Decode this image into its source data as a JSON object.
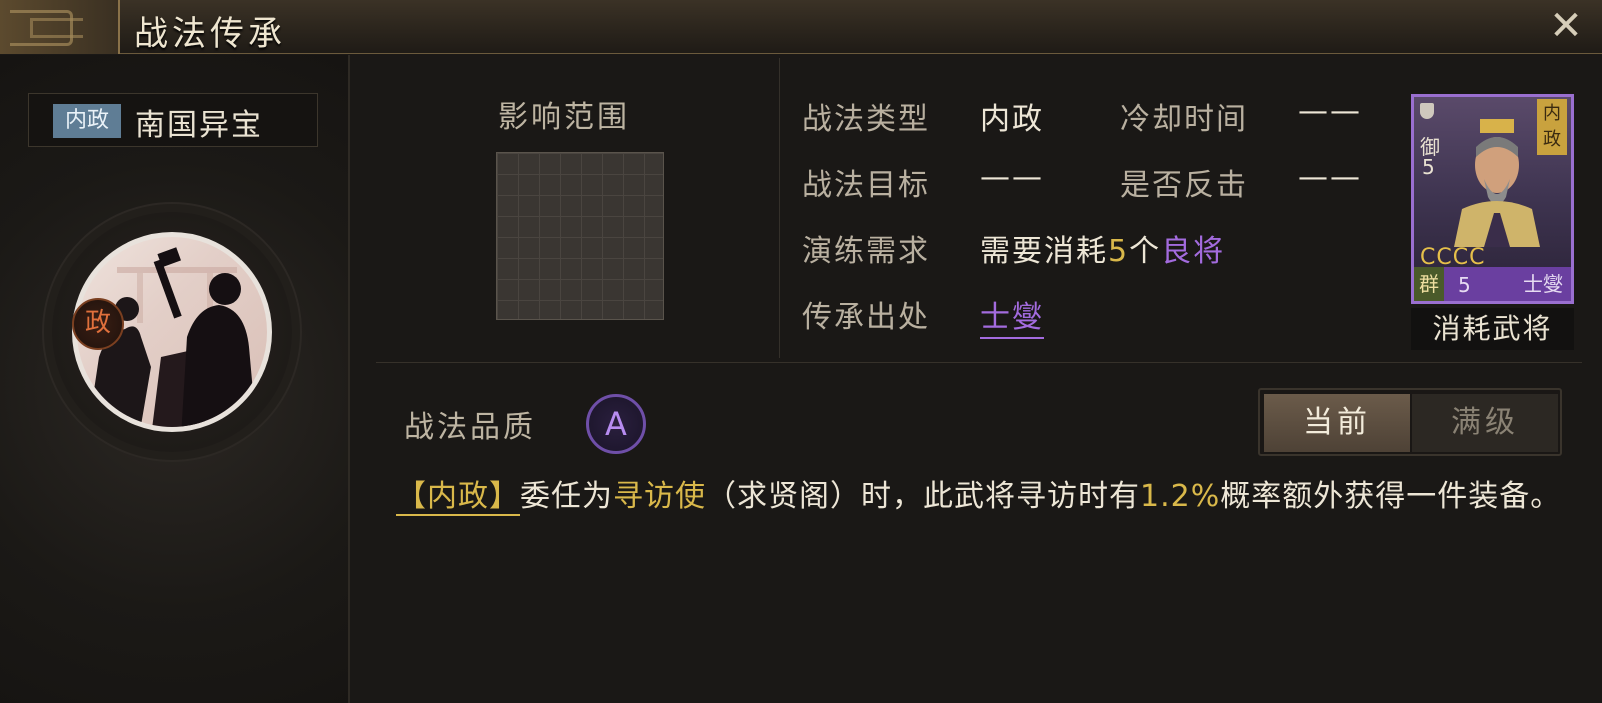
{
  "window": {
    "title": "战法传承",
    "close_glyph": "✕"
  },
  "skill": {
    "type_tag": "内政",
    "name": "南国异宝",
    "badge": "政"
  },
  "range": {
    "label": "影响范围"
  },
  "props": {
    "type_label": "战法类型",
    "type_value": "内政",
    "cooldown_label": "冷却时间",
    "cooldown_value": "——",
    "target_label": "战法目标",
    "target_value": "——",
    "counter_label": "是否反击",
    "counter_value": "——",
    "drill_label": "演练需求",
    "drill_prefix": "需要消耗",
    "drill_count": "5",
    "drill_unit": "个",
    "drill_item": "良将",
    "source_label": "传承出处",
    "source_value": "士燮"
  },
  "card": {
    "corner_top": "御",
    "corner_level": "5",
    "tag": "内政",
    "stars": "CCCC",
    "faction": "群",
    "level": "5",
    "name": "士燮",
    "label": "消耗武将",
    "border_color": "#9a6fd0"
  },
  "quality": {
    "label": "战法品质",
    "grade": "A"
  },
  "tabs": {
    "current": "当前",
    "max": "满级",
    "active": "current"
  },
  "description": {
    "tag": "【内政】",
    "t1": "委任为",
    "role": "寻访使",
    "t2": "（求贤阁）时，此武将寻访时有",
    "chance": "1.2%",
    "t3": "概率额外获得一件装备。"
  },
  "colors": {
    "accent_gold": "#d9b84a",
    "accent_purple": "#a36bde",
    "tag_blue": "#5f7d95"
  }
}
